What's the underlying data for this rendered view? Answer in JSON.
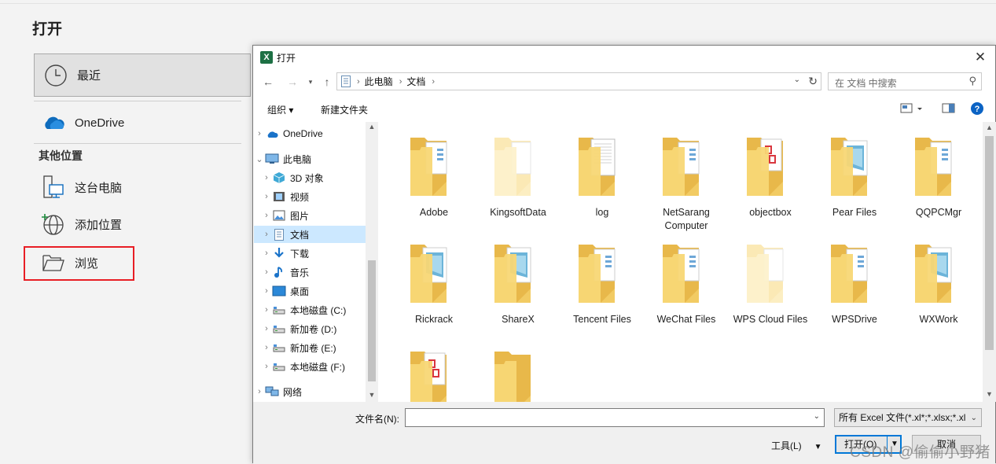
{
  "backstage": {
    "title": "打开",
    "recent_label": "最近",
    "onedrive_label": "OneDrive",
    "other_locations_heading": "其他位置",
    "this_pc_label": "这台电脑",
    "add_place_label": "添加位置",
    "browse_label": "浏览",
    "highlight_color": "#e81e25"
  },
  "dialog": {
    "title": "打开",
    "close_glyph": "✕",
    "address": {
      "crumbs": [
        "此电脑",
        "文档"
      ]
    },
    "search_placeholder": "在 文档 中搜索",
    "toolbar": {
      "organize": "组织 ▾",
      "new_folder": "新建文件夹"
    },
    "tree": [
      {
        "label": "OneDrive",
        "icon": "cloud-icon",
        "arrow": "›"
      },
      {
        "label": "此电脑",
        "icon": "computer-icon",
        "arrow": "⌄"
      },
      {
        "label": "3D 对象",
        "icon": "cube-icon",
        "arrow": "›"
      },
      {
        "label": "视频",
        "icon": "video-icon",
        "arrow": "›"
      },
      {
        "label": "图片",
        "icon": "picture-icon",
        "arrow": "›"
      },
      {
        "label": "文档",
        "icon": "document-icon",
        "arrow": "›",
        "selected": true
      },
      {
        "label": "下载",
        "icon": "download-icon",
        "arrow": "›"
      },
      {
        "label": "音乐",
        "icon": "music-icon",
        "arrow": "›"
      },
      {
        "label": "桌面",
        "icon": "desktop-icon",
        "arrow": "›"
      },
      {
        "label": "本地磁盘 (C:)",
        "icon": "drive-icon",
        "arrow": "›"
      },
      {
        "label": "新加卷 (D:)",
        "icon": "drive-icon",
        "arrow": "›"
      },
      {
        "label": "新加卷 (E:)",
        "icon": "drive-icon",
        "arrow": "›"
      },
      {
        "label": "本地磁盘 (F:)",
        "icon": "drive-icon",
        "arrow": "›"
      },
      {
        "label": "网络",
        "icon": "network-icon",
        "arrow": "›"
      }
    ],
    "files": [
      {
        "name": "Adobe",
        "variant": "docs"
      },
      {
        "name": "KingsoftData",
        "variant": "pale"
      },
      {
        "name": "log",
        "variant": "text"
      },
      {
        "name": "NetSarang Computer",
        "variant": "docs"
      },
      {
        "name": "objectbox",
        "variant": "pdf"
      },
      {
        "name": "Pear Files",
        "variant": "blue"
      },
      {
        "name": "QQPCMgr",
        "variant": "docs"
      },
      {
        "name": "Rickrack",
        "variant": "blue"
      },
      {
        "name": "ShareX",
        "variant": "blue"
      },
      {
        "name": "Tencent Files",
        "variant": "docs"
      },
      {
        "name": "WeChat Files",
        "variant": "docs"
      },
      {
        "name": "WPS Cloud Files",
        "variant": "pale"
      },
      {
        "name": "WPSDrive",
        "variant": "docs"
      },
      {
        "name": "WXWork",
        "variant": "blue"
      },
      {
        "name": "",
        "variant": "pdf"
      },
      {
        "name": "",
        "variant": "plain"
      }
    ],
    "filename_label": "文件名(N):",
    "filename_value": "",
    "filter_value": "所有 Excel 文件(*.xl*;*.xlsx;*.xl",
    "tools_label": "工具(L)",
    "open_label": "打开(O)",
    "cancel_label": "取消"
  },
  "watermark": "CSDN @偷偷小野猪",
  "colors": {
    "folder": "#f8d775",
    "folder_dark": "#e8b84a",
    "selected_bg": "#cce8ff",
    "excel_green": "#1d7044",
    "accent": "#0078d7"
  }
}
